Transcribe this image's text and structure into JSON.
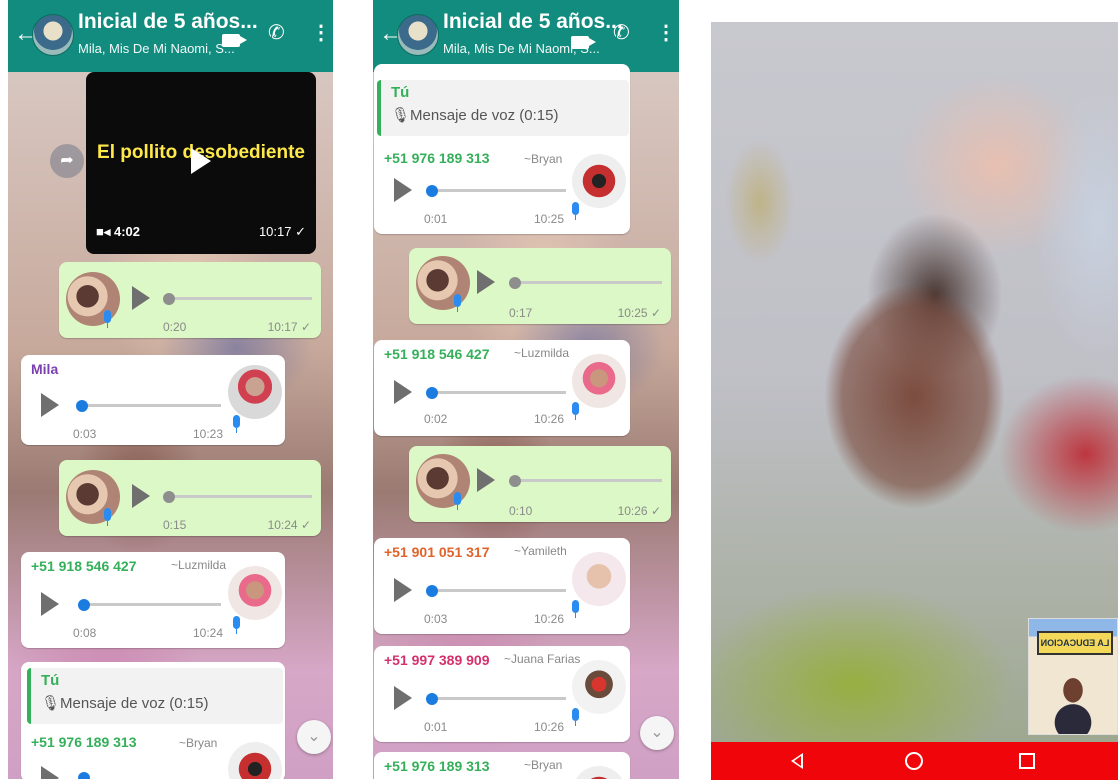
{
  "colors": {
    "header": "#128c7e",
    "bubble_in": "#ffffff",
    "bubble_out": "#dcf8c6",
    "knob": "#1a7be0",
    "mic": "#2a8cf0",
    "quote": "#35b05a",
    "nav_bar": "#f0060a"
  },
  "chat_left": {
    "header": {
      "title": "Inicial de 5 años...",
      "subtitle": "Mila, Mis De Mi Naomi, S..."
    },
    "video": {
      "title": "El pollito desobediente",
      "length": "4:02",
      "time": "10:17 ✓"
    },
    "messages": [
      {
        "type": "voice_out",
        "duration": "0:20",
        "time": "10:17 ✓"
      },
      {
        "type": "voice_in",
        "sender": "Mila",
        "sender_color": "#7a3fb0",
        "duration": "0:03",
        "time": "10:23"
      },
      {
        "type": "voice_out",
        "duration": "0:15",
        "time": "10:24 ✓"
      },
      {
        "type": "voice_in",
        "sender": "+51 918 546 427",
        "alias": "~Luzmilda",
        "sender_color": "#35b05a",
        "duration": "0:08",
        "time": "10:24"
      },
      {
        "type": "reply_in",
        "quote_name": "Tú",
        "quote_text": "🎙Mensaje de voz (0:15)",
        "sender": "+51 976 189 313",
        "alias": "~Bryan",
        "sender_color": "#35b05a"
      }
    ]
  },
  "chat_mid": {
    "header": {
      "title": "Inicial de 5 años...",
      "subtitle": "Mila, Mis De Mi Naomi, S..."
    },
    "messages": [
      {
        "type": "reply_in",
        "quote_name": "Tú",
        "quote_text": "🎙Mensaje de voz (0:15)",
        "sender": "+51 976 189 313",
        "alias": "~Bryan",
        "sender_color": "#35b05a",
        "duration": "0:01",
        "time": "10:25"
      },
      {
        "type": "voice_out",
        "duration": "0:17",
        "time": "10:25 ✓"
      },
      {
        "type": "voice_in",
        "sender": "+51 918 546 427",
        "alias": "~Luzmilda",
        "sender_color": "#35b05a",
        "duration": "0:02",
        "time": "10:26"
      },
      {
        "type": "voice_out",
        "duration": "0:10",
        "time": "10:26 ✓"
      },
      {
        "type": "voice_in",
        "sender": "+51 901 051 317",
        "alias": "~Yamileth",
        "sender_color": "#e0632a",
        "duration": "0:03",
        "time": "10:26"
      },
      {
        "type": "voice_in",
        "sender": "+51 997 389 909",
        "alias": "~Juana Farias",
        "sender_color": "#d6306c",
        "duration": "0:01",
        "time": "10:26"
      },
      {
        "type": "voice_in",
        "sender": "+51 976 189 313",
        "alias": "~Bryan",
        "sender_color": "#35b05a"
      }
    ]
  },
  "video_call": {
    "pip_sign": "LA EDUCACION"
  }
}
